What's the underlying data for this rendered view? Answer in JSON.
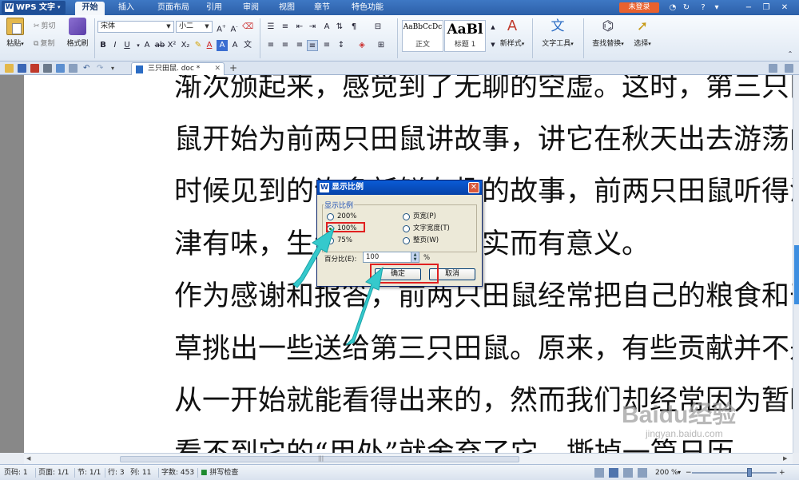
{
  "app": {
    "name": "WPS 文字"
  },
  "menu": {
    "tabs": [
      "开始",
      "插入",
      "页面布局",
      "引用",
      "审阅",
      "视图",
      "章节",
      "特色功能"
    ],
    "active_index": 0,
    "login": "未登录"
  },
  "ribbon": {
    "paste": "粘贴",
    "cut": "剪切",
    "copy": "复制",
    "format_painter": "格式刷",
    "font_name": "宋体",
    "font_size": "小二",
    "style_normal_preview": "AaBbCcDc",
    "style_normal_caption": "正文",
    "style_title_preview": "AaBl",
    "style_title_caption": "标题 1",
    "new_style": "新样式",
    "text_tools": "文字工具",
    "find_replace": "查找替换",
    "select": "选择"
  },
  "doc_tab": {
    "name": "三只田鼠. doc *"
  },
  "document": {
    "lines": [
      "渐次颁起来，感觉到了无聊的空虚。这时，第三只田",
      "鼠开始为前两只田鼠讲故事，讲它在秋天出去游荡的",
      "时候见到的许多新鲜有趣的故事，前两只田鼠听得津",
      "津有味，生活一下变得充实而有意义。",
      "作为感谢和报答，前两只田鼠经常把自己的粮食和干",
      "草挑出一些送给第三只田鼠。原来，有些贡献并不是",
      "从一开始就能看得出来的，然而我们却经常因为暂时",
      "看不到它的“用处”就舍弃了它。撕掉一篇日历，"
    ]
  },
  "dialog": {
    "title": "显示比例",
    "group_label": "显示比例",
    "options_left": [
      "200%",
      "100%",
      "75%"
    ],
    "options_right": [
      "页宽(P)",
      "文字宽度(T)",
      "整页(W)"
    ],
    "selected": "100%",
    "percent_label": "百分比(E):",
    "percent_value": "100",
    "percent_unit": "%",
    "ok": "确定",
    "cancel": "取消"
  },
  "status": {
    "page_code": "页码: 1",
    "page": "页面: 1/1",
    "section": "节: 1/1",
    "row": "行: 3",
    "column": "列: 11",
    "word_count": "字数: 453",
    "spell_check": "拼写检查",
    "zoom": "200 %",
    "zoom_level_fraction": 0.68
  },
  "watermark": {
    "text": "Baidu经验",
    "sub": "jingyan.baidu.com"
  },
  "colors": {
    "title_bar": "#2c5fa8",
    "login_badge": "#e8612e",
    "dialog_title": "#0642a8",
    "highlight": "#e02020",
    "arrow": "#35c9cc"
  }
}
